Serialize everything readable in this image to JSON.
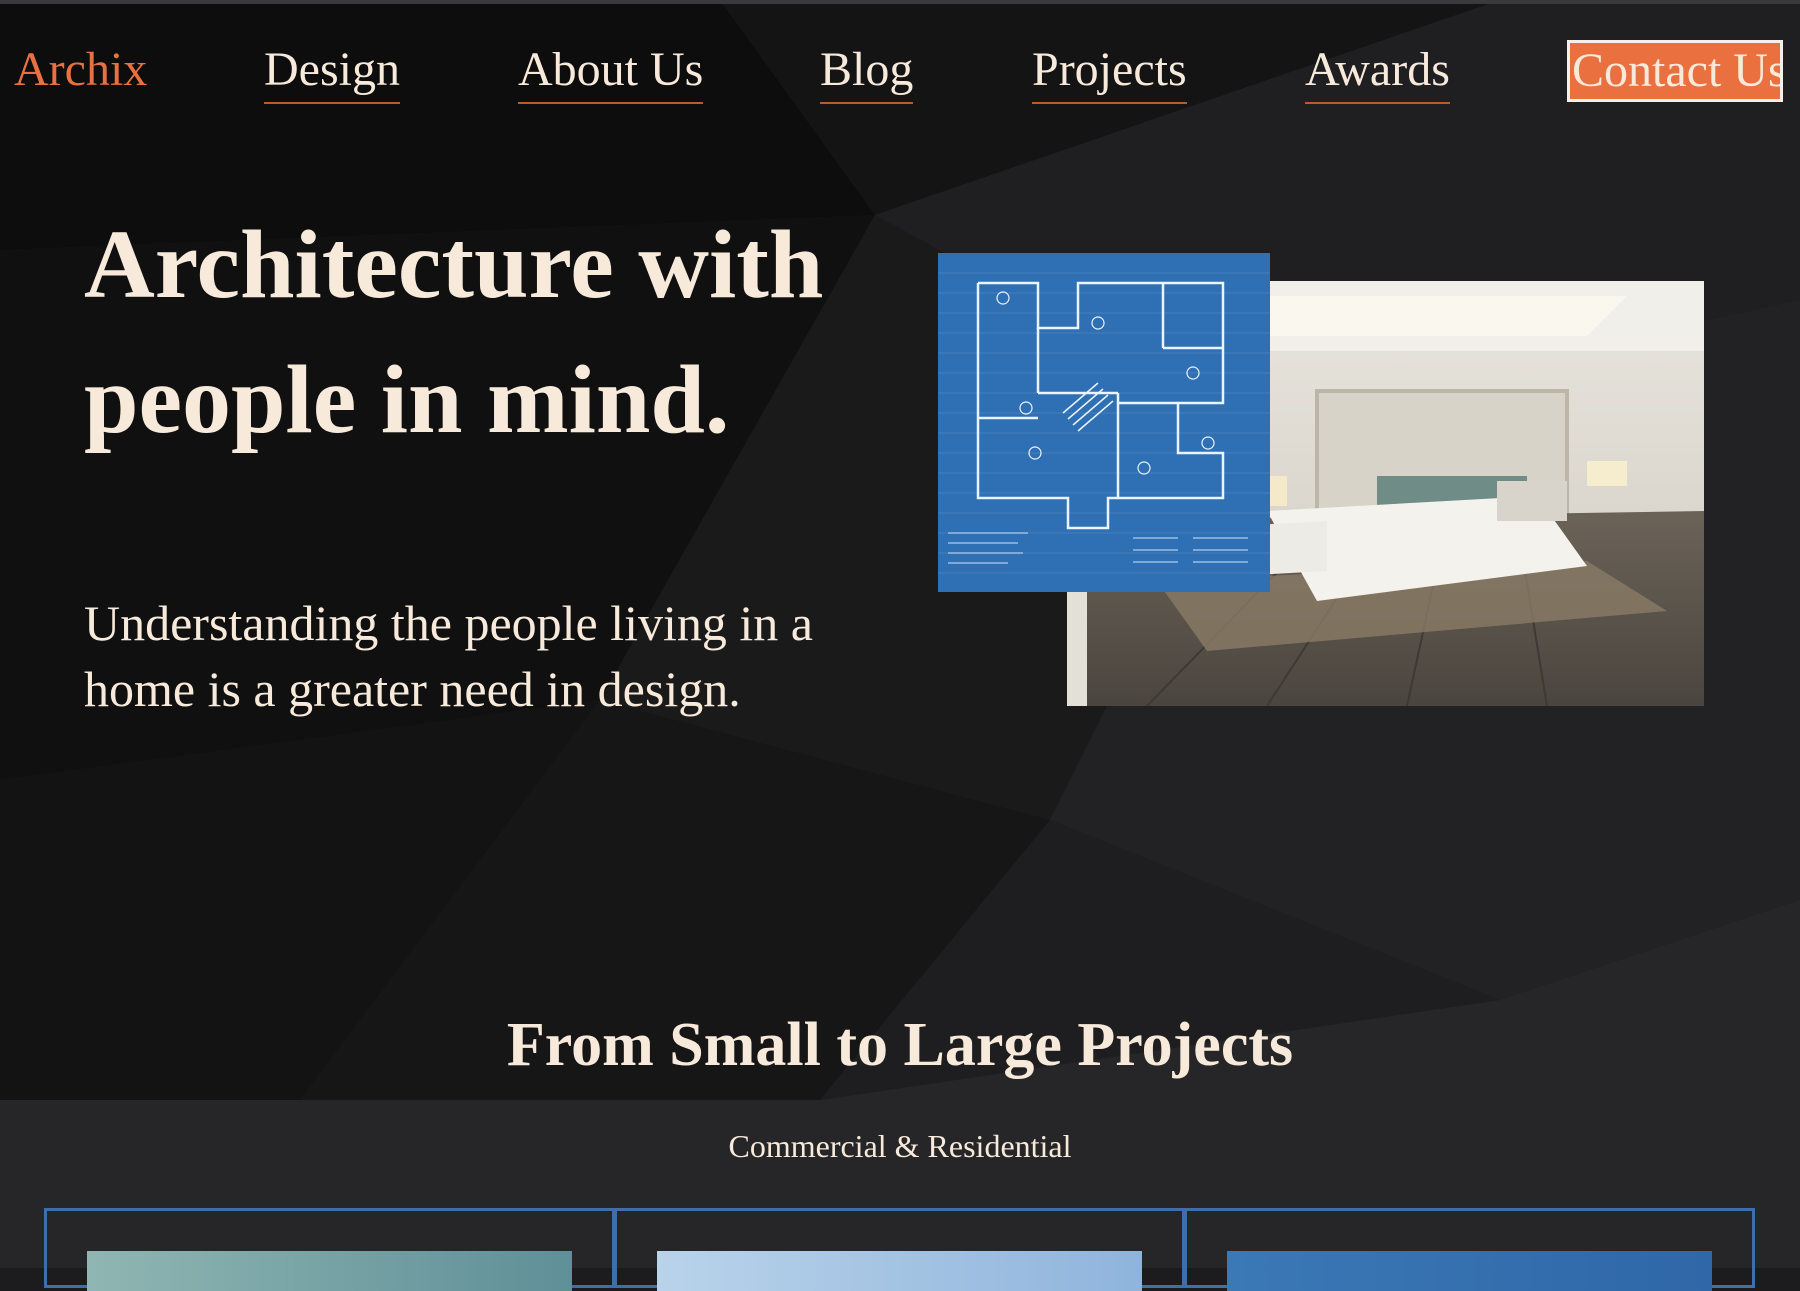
{
  "brand": {
    "name": "Archix"
  },
  "nav": {
    "links": [
      "Design",
      "About Us",
      "Blog",
      "Projects",
      "Awards"
    ],
    "contact_label": "Contact Us"
  },
  "hero": {
    "title": "Architecture with people in mind.",
    "subtitle": "Understanding the people living in a home is a greater need in design."
  },
  "section": {
    "title": "From Small to Large Projects",
    "subtitle": "Commercial & Residential"
  },
  "colors": {
    "accent": "#e8713f",
    "text": "#f8eadb",
    "background": "#1c1c1e",
    "card_border": "#3f6fa8"
  }
}
